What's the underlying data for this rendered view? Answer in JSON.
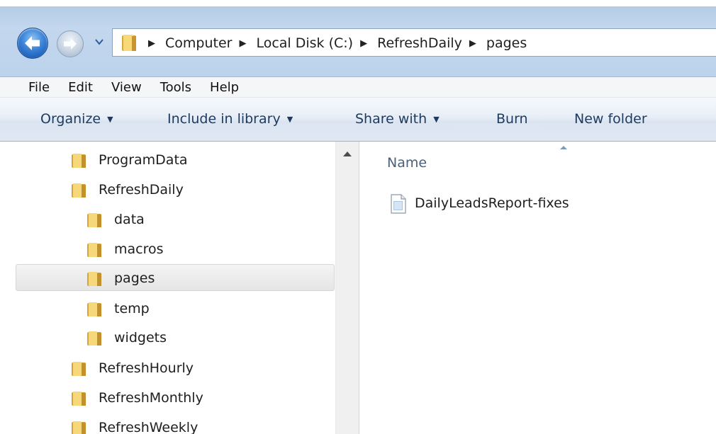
{
  "navigation": {
    "back_icon": "back-arrow-icon",
    "forward_icon": "forward-arrow-icon",
    "recent_icon": "chevron-down-icon"
  },
  "address": {
    "icon": "folder-icon",
    "crumbs": [
      "Computer",
      "Local Disk (C:)",
      "RefreshDaily",
      "pages"
    ]
  },
  "menu": {
    "items": [
      "File",
      "Edit",
      "View",
      "Tools",
      "Help"
    ]
  },
  "toolbar": {
    "organize": "Organize",
    "include_in_library": "Include in library",
    "share_with": "Share with",
    "burn": "Burn",
    "new_folder": "New folder"
  },
  "tree": {
    "items": [
      {
        "label": "ProgramData"
      },
      {
        "label": "RefreshDaily"
      },
      {
        "label": "data"
      },
      {
        "label": "macros"
      },
      {
        "label": "pages",
        "selected": true
      },
      {
        "label": "temp"
      },
      {
        "label": "widgets"
      },
      {
        "label": "RefreshHourly"
      },
      {
        "label": "RefreshMonthly"
      },
      {
        "label": "RefreshWeekly"
      }
    ]
  },
  "content": {
    "column_name": "Name",
    "files": [
      {
        "name": "DailyLeadsReport-fixes",
        "icon": "document-icon"
      }
    ]
  },
  "colors": {
    "titlebar": "#c3d7ee",
    "folder": "#e9c35a",
    "selection": "#e5e5e5",
    "command_text": "#1e3a5f"
  }
}
